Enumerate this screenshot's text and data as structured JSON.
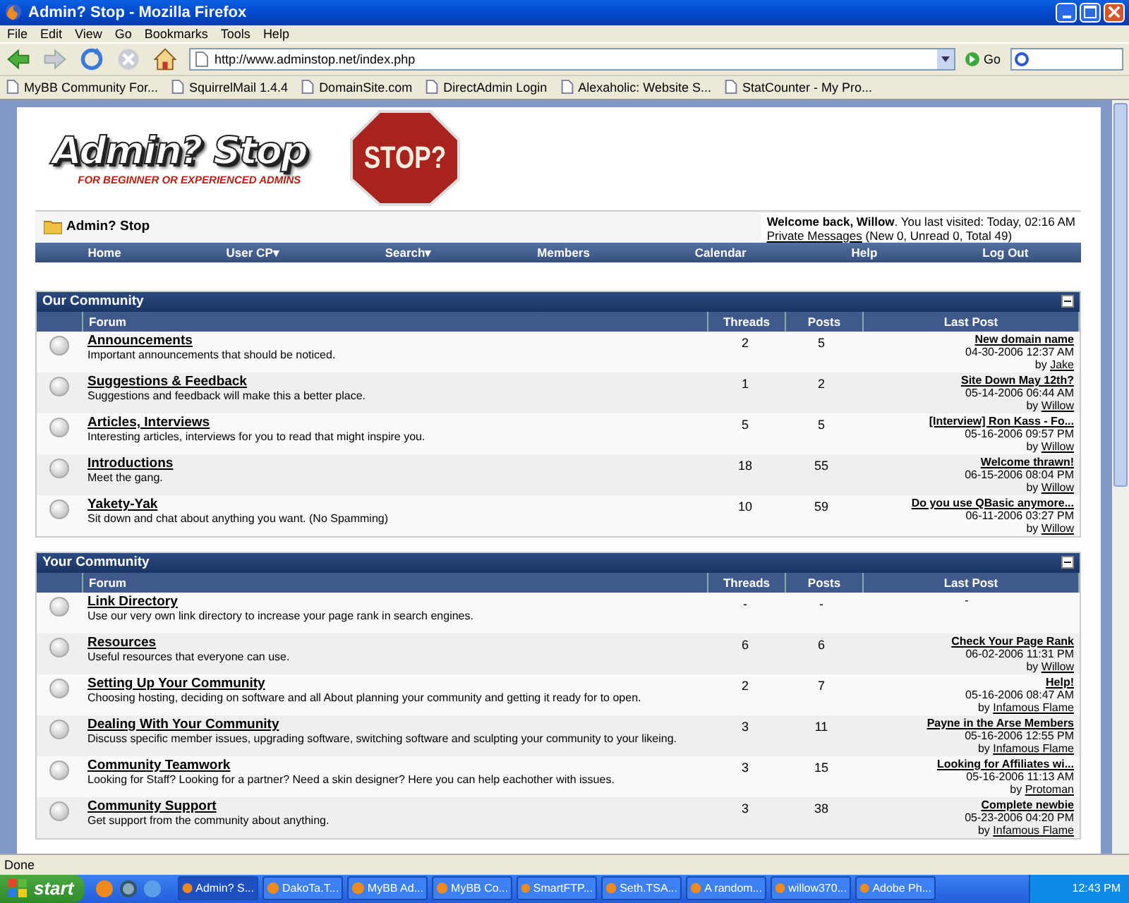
{
  "window": {
    "title": "Admin? Stop - Mozilla Firefox"
  },
  "menu": [
    "File",
    "Edit",
    "View",
    "Go",
    "Bookmarks",
    "Tools",
    "Help"
  ],
  "address": "http://www.adminstop.net/index.php",
  "go_label": "Go",
  "bookmarks": [
    "MyBB Community For...",
    "SquirrelMail 1.4.4",
    "DomainSite.com",
    "DirectAdmin Login",
    "Alexaholic: Website S...",
    "StatCounter - My Pro..."
  ],
  "site": {
    "logo": "Admin? Stop",
    "tagline": "FOR BEGINNER OR EXPERIENCED ADMINS",
    "sign": "STOP?",
    "breadcrumb": "Admin? Stop",
    "welcome": "**Welcome back, Willow**. You last visited: Today, 02:16 AM",
    "pm_link": "Private Messages",
    "pm_counts": "(New 0, Unread 0, Total 49)",
    "nav": [
      "Home",
      "User CP▾",
      "Search▾",
      "Members",
      "Calendar",
      "Help",
      "Log Out"
    ]
  },
  "categories": [
    {
      "title": "Our Community",
      "columns": [
        "Forum",
        "Threads",
        "Posts",
        "Last Post"
      ],
      "forums": [
        {
          "name": "Announcements",
          "description": "Important announcements that should be noticed.",
          "threads": "2",
          "posts": "5",
          "last_post": {
            "kind": "post",
            "title": "New domain name",
            "date": "04-30-2006 12:37 AM",
            "by": "by",
            "author": "Jake"
          }
        },
        {
          "name": "Suggestions & Feedback",
          "description": "Suggestions and feedback will make this a better place.",
          "threads": "1",
          "posts": "2",
          "last_post": {
            "kind": "post",
            "title": "Site Down May 12th?",
            "date": "05-14-2006 06:44 AM",
            "by": "by",
            "author": "Willow"
          }
        },
        {
          "name": "Articles, Interviews",
          "description": "Interesting articles, interviews for you to read that might inspire you.",
          "threads": "5",
          "posts": "5",
          "last_post": {
            "kind": "post",
            "title": "[Interview] Ron Kass - Fo...",
            "date": "05-16-2006 09:57 PM",
            "by": "by",
            "author": "Willow"
          }
        },
        {
          "name": "Introductions",
          "description": "Meet the gang.",
          "threads": "18",
          "posts": "55",
          "last_post": {
            "kind": "post",
            "title": "Welcome thrawn!",
            "date": "06-15-2006 08:04 PM",
            "by": "by",
            "author": "Willow"
          }
        },
        {
          "name": "Yakety-Yak",
          "description": "Sit down and chat about anything you want. (No Spamming)",
          "threads": "10",
          "posts": "59",
          "last_post": {
            "kind": "post",
            "title": "Do you use QBasic anymore...",
            "date": "06-11-2006 03:27 PM",
            "by": "by",
            "author": "Willow"
          }
        }
      ]
    },
    {
      "title": "Your Community",
      "columns": [
        "Forum",
        "Threads",
        "Posts",
        "Last Post"
      ],
      "forums": [
        {
          "name": "Link Directory",
          "description": "Use our very own link directory to increase your page rank in search engines.",
          "threads": "-",
          "posts": "-",
          "last_post": {
            "kind": "none",
            "title": "-"
          }
        },
        {
          "name": "Resources",
          "description": "Useful resources that everyone can use.",
          "threads": "6",
          "posts": "6",
          "last_post": {
            "kind": "post",
            "title": "Check Your Page Rank",
            "date": "06-02-2006 11:31 PM",
            "by": "by",
            "author": "Willow"
          }
        },
        {
          "name": "Setting Up Your Community",
          "description": "Choosing hosting, deciding on software and all About planning your community and getting it ready for to open.",
          "threads": "2",
          "posts": "7",
          "last_post": {
            "kind": "post",
            "title": "Help!",
            "date": "05-16-2006 08:47 AM",
            "by": "by",
            "author": "Infamous Flame"
          }
        },
        {
          "name": "Dealing With Your Community",
          "description": "Discuss specific member issues, upgrading software, switching software and sculpting your community to your likeing.",
          "threads": "3",
          "posts": "11",
          "last_post": {
            "kind": "post",
            "title": "Payne in the Arse Members",
            "date": "05-16-2006 12:55 PM",
            "by": "by",
            "author": "Infamous Flame"
          }
        },
        {
          "name": "Community Teamwork",
          "description": "Looking for Staff? Looking for a partner? Need a skin designer? Here you can help eachother with issues.",
          "threads": "3",
          "posts": "15",
          "last_post": {
            "kind": "post",
            "title": "Looking for Affiliates wi...",
            "date": "05-16-2006 11:13 AM",
            "by": "by",
            "author": "Protoman"
          }
        },
        {
          "name": "Community Support",
          "description": "Get support from the community about anything.",
          "threads": "3",
          "posts": "38",
          "last_post": {
            "kind": "post",
            "title": "Complete newbie",
            "date": "05-23-2006 04:20 PM",
            "by": "by",
            "author": "Infamous Flame"
          }
        }
      ]
    }
  ],
  "status": "Done",
  "taskbar": {
    "start": "start",
    "tasks": [
      {
        "label": "Admin? S...",
        "selected": true
      },
      {
        "label": "DakoTa.T...",
        "selected": false
      },
      {
        "label": "MyBB Ad...",
        "selected": false
      },
      {
        "label": "MyBB Co...",
        "selected": false
      },
      {
        "label": "SmartFTP...",
        "selected": false
      },
      {
        "label": "Seth.TSA...",
        "selected": false
      },
      {
        "label": "A random...",
        "selected": false
      },
      {
        "label": "willow370...",
        "selected": false
      },
      {
        "label": "Adobe Ph...",
        "selected": false
      }
    ],
    "clock": "12:43 PM"
  }
}
